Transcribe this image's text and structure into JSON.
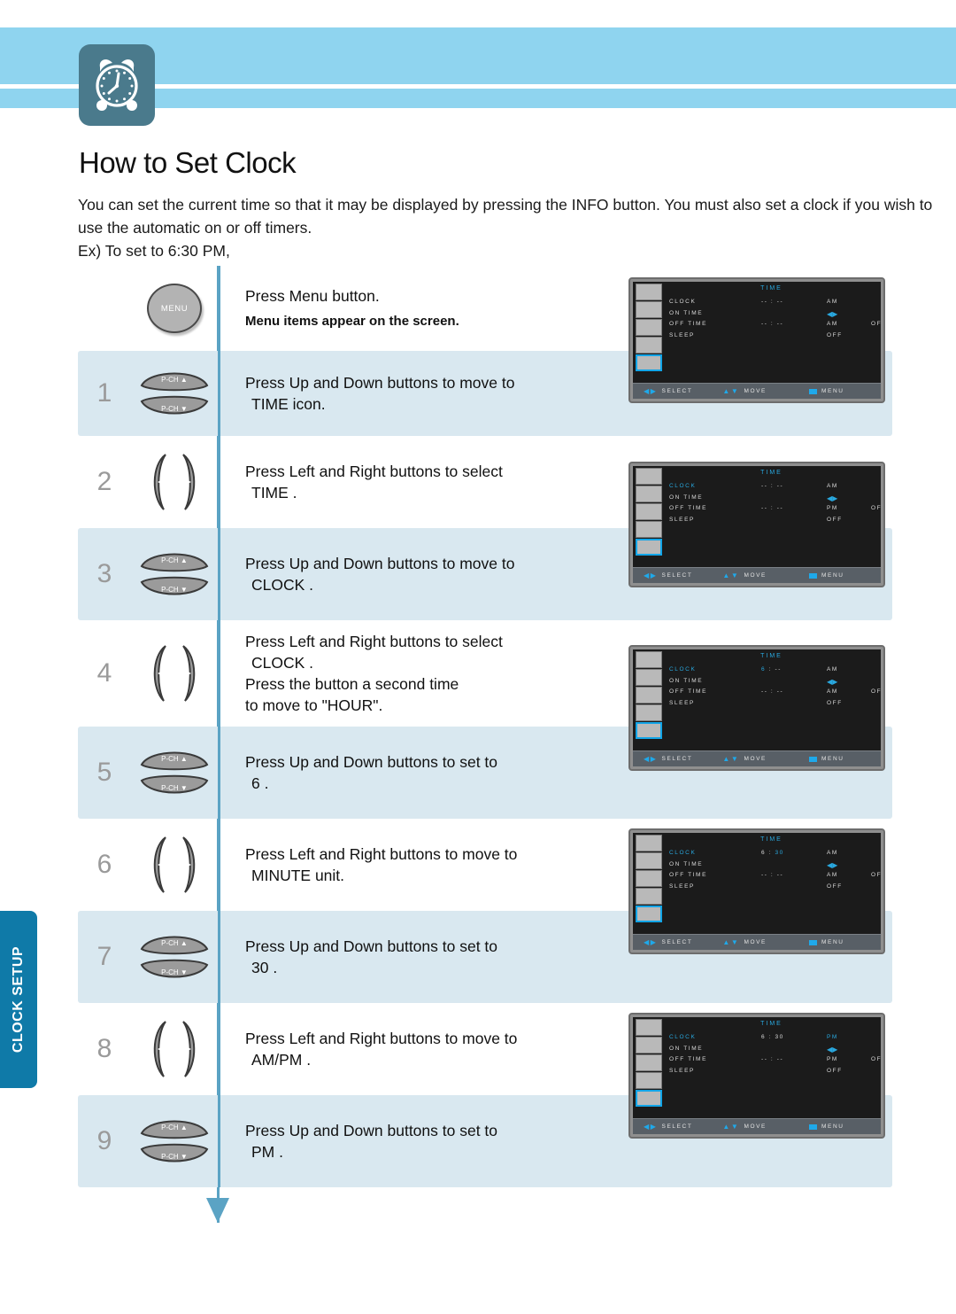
{
  "header": {
    "badge_icon": "alarm-clock-icon"
  },
  "title": "How to Set Clock",
  "intro": {
    "line1": "You can set the current time so that it may be displayed by pressing the  INFO  button. You must also set a clock if",
    "line2": "you wish to use the automatic on or off timers.",
    "line3": "Ex) To set to 6:30 PM,"
  },
  "side_tab": {
    "label": "CLOCK SETUP"
  },
  "steps": [
    {
      "num": "",
      "button": "menu",
      "button_label": "MENU",
      "line1": "Press Menu button.",
      "line2": "",
      "line3": "",
      "sub": "Menu items appear on the screen.",
      "tinted": false
    },
    {
      "num": "1",
      "button": "updown",
      "line1": "Press Up and Down buttons to move to",
      "line2": "TIME  icon.",
      "line3": "",
      "sub": "",
      "tinted": true
    },
    {
      "num": "2",
      "button": "leftright",
      "line1": "Press Left and Right buttons to select",
      "line2": "TIME .",
      "line3": "",
      "sub": "",
      "tinted": false
    },
    {
      "num": "3",
      "button": "updown",
      "line1": "Press Up and Down buttons to move to",
      "line2": "CLOCK .",
      "line3": "",
      "sub": "",
      "tinted": true
    },
    {
      "num": "4",
      "button": "leftright",
      "line1": "Press Left and Right buttons to select",
      "line2": "CLOCK .",
      "line3": "Press the button a second time",
      "line4": "to move to \"HOUR\".",
      "sub": "",
      "tinted": false
    },
    {
      "num": "5",
      "button": "updown",
      "line1": "Press Up and Down buttons to set to",
      "line2": "6 .",
      "line3": "",
      "sub": "",
      "tinted": true
    },
    {
      "num": "6",
      "button": "leftright",
      "line1": "Press Left and Right buttons to move to",
      "line2": "MINUTE  unit.",
      "line3": "",
      "sub": "",
      "tinted": false
    },
    {
      "num": "7",
      "button": "updown",
      "line1": "Press Up and Down buttons to set to",
      "line2": "30 .",
      "line3": "",
      "sub": "",
      "tinted": true
    },
    {
      "num": "8",
      "button": "leftright",
      "line1": "Press Left and Right buttons to move to",
      "line2": "AM/PM .",
      "line3": "",
      "sub": "",
      "tinted": false
    },
    {
      "num": "9",
      "button": "updown",
      "line1": "Press Up and Down buttons to set to",
      "line2": "PM .",
      "line3": "",
      "sub": "",
      "tinted": true
    }
  ],
  "remote_labels": {
    "menu": "MENU",
    "p_ch_up": "P-CH",
    "p_ch_down": "P-CH"
  },
  "osd": {
    "title": "TIME",
    "labels": {
      "clock": "CLOCK",
      "on_time": "ON  TIME",
      "off_time": "OFF  TIME",
      "sleep": "SLEEP"
    },
    "status": {
      "select": "SELECT",
      "move": "MOVE",
      "menu": "MENU"
    },
    "screens": [
      {
        "id": "screen-1",
        "clock_label_hl": false,
        "clock_value": "-- : --",
        "clock_value_hour_hl": false,
        "clock_value_min_hl": false,
        "clock_ampm": "AM",
        "clock_ampm_hl": false,
        "off_time_value": "-- : --",
        "off_time_ampm": "AM",
        "off_time_off": "OFF",
        "sleep_value": "OFF"
      },
      {
        "id": "screen-2",
        "clock_label_hl": true,
        "clock_value": "-- : --",
        "clock_value_hour_hl": false,
        "clock_value_min_hl": false,
        "clock_ampm": "AM",
        "clock_ampm_hl": false,
        "off_time_value": "-- : --",
        "off_time_ampm": "PM",
        "off_time_off": "OFF",
        "sleep_value": "OFF"
      },
      {
        "id": "screen-3",
        "clock_label_hl": true,
        "clock_value": "6 : --",
        "clock_value_hour_hl": true,
        "clock_value_min_hl": false,
        "clock_ampm": "AM",
        "clock_ampm_hl": false,
        "off_time_value": "-- : --",
        "off_time_ampm": "AM",
        "off_time_off": "OFF",
        "sleep_value": "OFF"
      },
      {
        "id": "screen-4",
        "clock_label_hl": true,
        "clock_value": "6 : 30",
        "clock_value_hour_hl": false,
        "clock_value_min_hl": true,
        "clock_ampm": "AM",
        "clock_ampm_hl": false,
        "off_time_value": "-- : --",
        "off_time_ampm": "AM",
        "off_time_off": "OFF",
        "sleep_value": "OFF"
      },
      {
        "id": "screen-5",
        "clock_label_hl": true,
        "clock_value": "6 : 30",
        "clock_value_hour_hl": false,
        "clock_value_min_hl": false,
        "clock_ampm": "PM",
        "clock_ampm_hl": true,
        "off_time_value": "-- : --",
        "off_time_ampm": "PM",
        "off_time_off": "OFF",
        "sleep_value": "OFF"
      }
    ]
  },
  "colors": {
    "header_blue": "#8fd4ef",
    "badge_teal": "#4a7a8c",
    "accent_line": "#5ba3c4",
    "tinted_row": "#d9e8f0",
    "tab_blue": "#0f7aa8",
    "osd_highlight": "#29a8df"
  }
}
